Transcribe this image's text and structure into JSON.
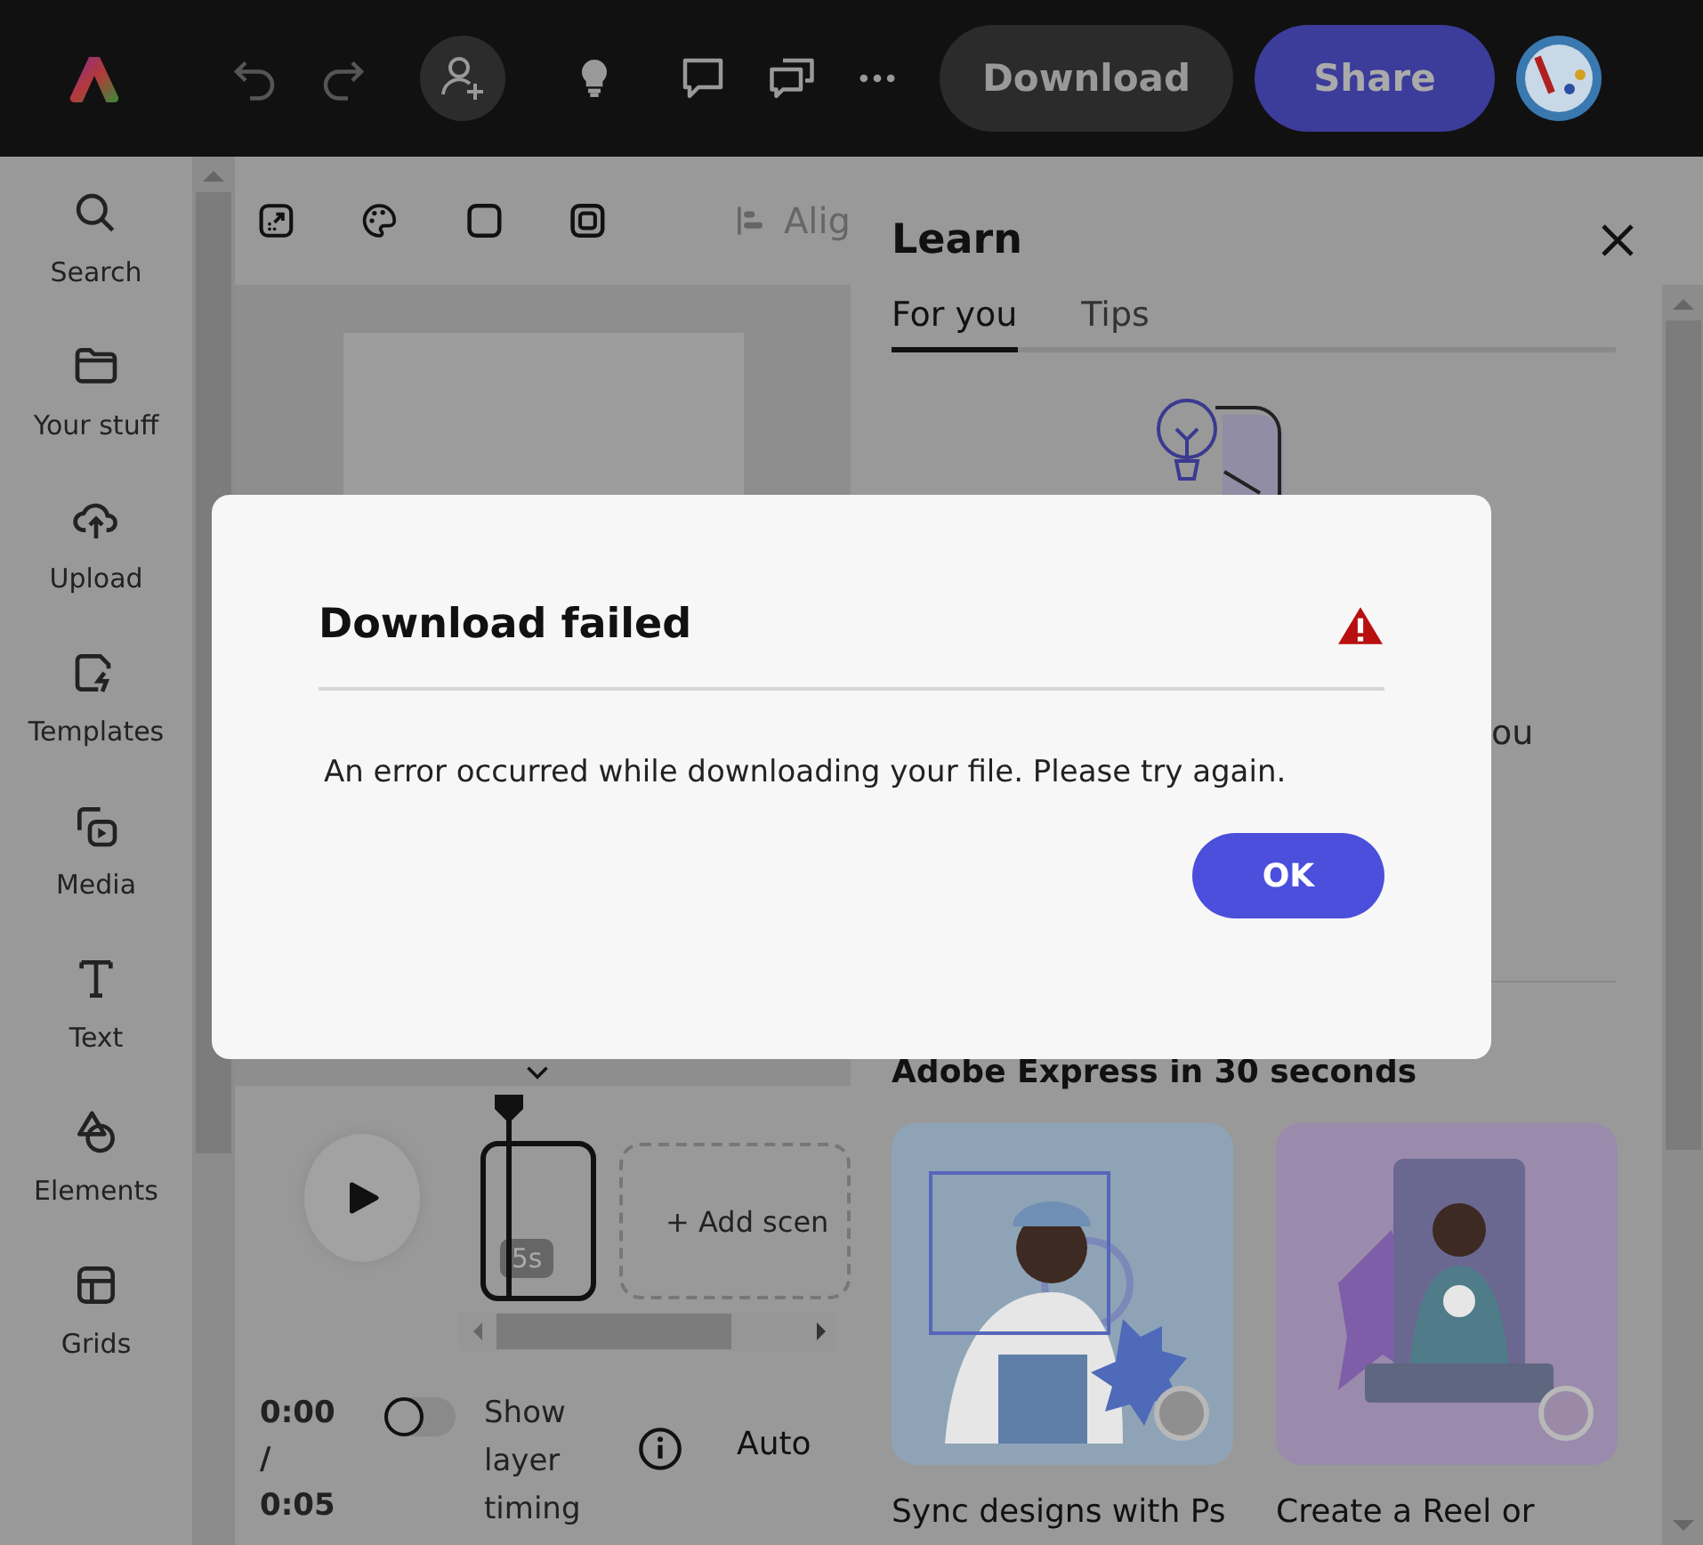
{
  "top_bar": {
    "download_button": "Download",
    "share_button": "Share"
  },
  "sidebar": {
    "items": [
      {
        "label": "Search"
      },
      {
        "label": "Your stuff"
      },
      {
        "label": "Upload"
      },
      {
        "label": "Templates"
      },
      {
        "label": "Media"
      },
      {
        "label": "Text"
      },
      {
        "label": "Elements"
      },
      {
        "label": "Grids"
      }
    ]
  },
  "canvas_toolbar": {
    "align_label": "Alig"
  },
  "timeline": {
    "duration_badge": "5s",
    "add_scene": "+ Add scen",
    "time_current": "0:00",
    "time_separator": "/",
    "time_total": "0:05",
    "layer_timing": {
      "label": "Show layer timing",
      "on": false
    },
    "auto_label": "Auto"
  },
  "learn_panel": {
    "title": "Learn",
    "tabs": [
      {
        "label": "For you",
        "selected": true
      },
      {
        "label": "Tips",
        "selected": false
      }
    ],
    "partial_text": "ou",
    "section_title": "Adobe Express in 30 seconds",
    "cards": [
      {
        "title": "Sync designs with Ps"
      },
      {
        "title": "Create a Reel or"
      }
    ]
  },
  "dialog": {
    "title": "Download failed",
    "message": "An error occurred while downloading your file. Please try again.",
    "ok_button": "OK"
  }
}
